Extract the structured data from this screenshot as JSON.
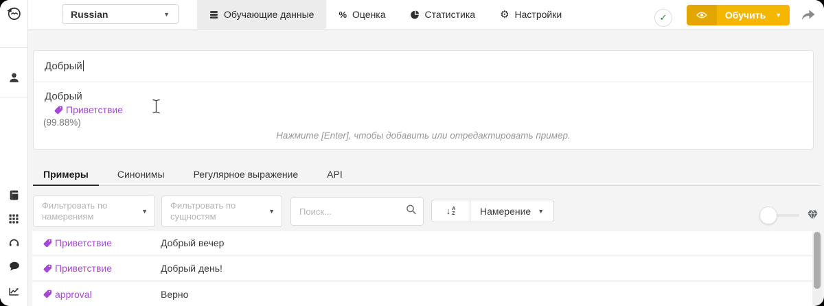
{
  "topbar": {
    "language_select": {
      "value": "Russian"
    },
    "tabs": [
      {
        "label": "Обучающие данные",
        "icon": "database-icon",
        "active": true
      },
      {
        "label": "Оценка",
        "icon": "percent-icon",
        "active": false
      },
      {
        "label": "Статистика",
        "icon": "pie-chart-icon",
        "active": false
      },
      {
        "label": "Настройки",
        "icon": "gear-icon",
        "active": false
      }
    ],
    "status_icon": "check-icon",
    "train_button": {
      "label": "Обучить"
    }
  },
  "editor": {
    "input_value": "Добрый",
    "preview": {
      "utterance": "Добрый",
      "intent_label": "Приветствие",
      "confidence": "(99.88%)"
    },
    "hint": "Нажмите [Enter], чтобы добавить или отредактировать пример."
  },
  "section_tabs": [
    {
      "label": "Примеры",
      "active": true
    },
    {
      "label": "Синонимы",
      "active": false
    },
    {
      "label": "Регулярное выражение",
      "active": false
    },
    {
      "label": "API",
      "active": false
    }
  ],
  "filter_bar": {
    "intent_filter_placeholder": "Фильтровать по намерениям",
    "entity_filter_placeholder": "Фильтровать по сущностям",
    "search_placeholder": "Поиск...",
    "sort_select_label": "Намерение"
  },
  "utterances": {
    "rows": [
      {
        "intent": "Приветствие",
        "text": "Добрый вечер"
      },
      {
        "intent": "Приветствие",
        "text": "Добрый день!"
      },
      {
        "intent": "approval",
        "text": "Верно"
      }
    ]
  },
  "colors": {
    "accent_yellow": "#f3b700",
    "accent_yellow_dark": "#e2a600",
    "intent_purple": "#a549d5",
    "success_green": "#2e7d32",
    "page_background": "#f4f4f4"
  }
}
